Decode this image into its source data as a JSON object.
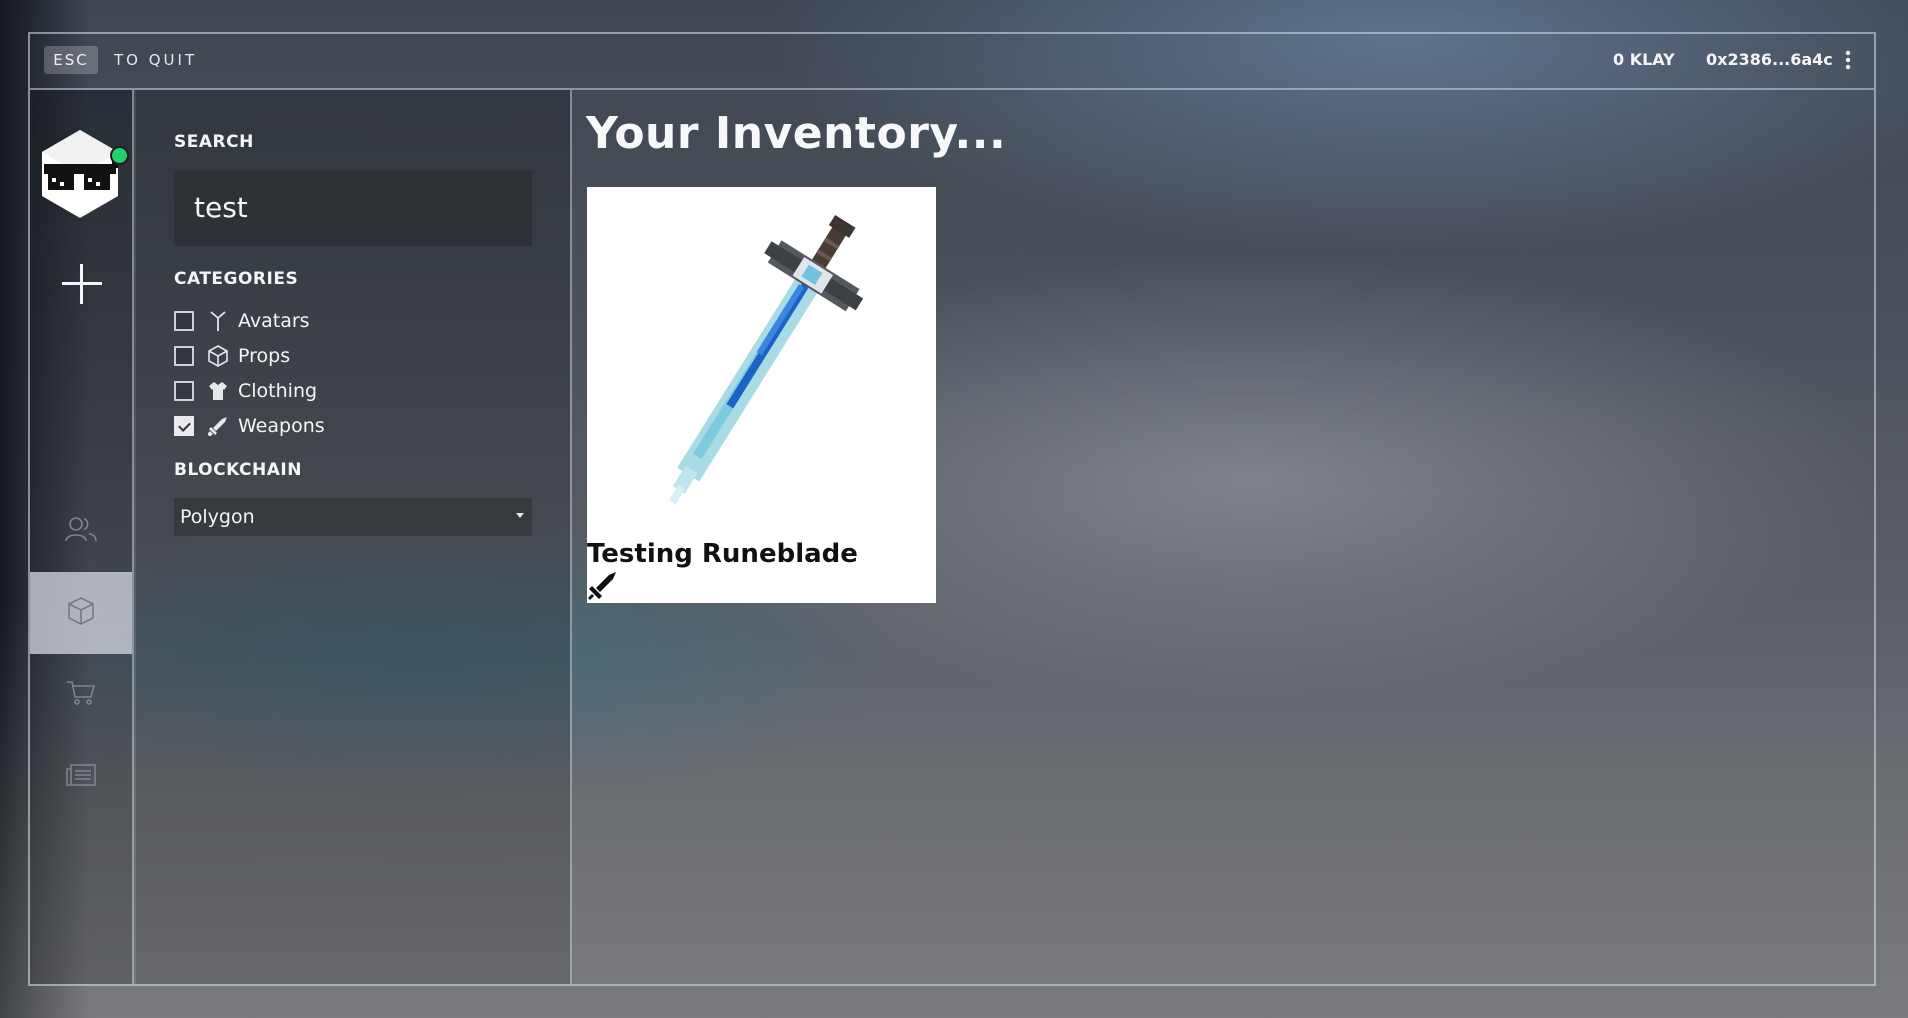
{
  "topbar": {
    "esc_key": "ESC",
    "quit_text": "TO QUIT",
    "balance": "0 KLAY",
    "wallet_address": "0x2386...6a4c",
    "more_icon": "more-vertical-icon"
  },
  "nav": {
    "avatar": "sunglasses-cube-avatar",
    "online_status_color": "#22d16a",
    "items": [
      {
        "icon": "plus-icon"
      },
      {
        "icon": "friends-icon"
      },
      {
        "icon": "inventory-box-icon",
        "active": true
      },
      {
        "icon": "cart-icon"
      },
      {
        "icon": "news-icon"
      }
    ]
  },
  "filters": {
    "search_title": "SEARCH",
    "search_value": "test",
    "categories_title": "CATEGORIES",
    "categories": [
      {
        "label": "Avatars",
        "icon": "avatar-figure-icon",
        "checked": false
      },
      {
        "label": "Props",
        "icon": "cube-icon",
        "checked": false
      },
      {
        "label": "Clothing",
        "icon": "shirt-icon",
        "checked": false
      },
      {
        "label": "Weapons",
        "icon": "sword-icon",
        "checked": true
      }
    ],
    "blockchain_title": "BLOCKCHAIN",
    "blockchain_value": "Polygon"
  },
  "main": {
    "title": "Your Inventory...",
    "items": [
      {
        "name": "Testing Runeblade",
        "type_icon": "sword-icon"
      }
    ]
  },
  "colors": {
    "accent_online": "#22d16a",
    "card_bg": "#ffffff",
    "frame_line": "#dce1eb"
  }
}
